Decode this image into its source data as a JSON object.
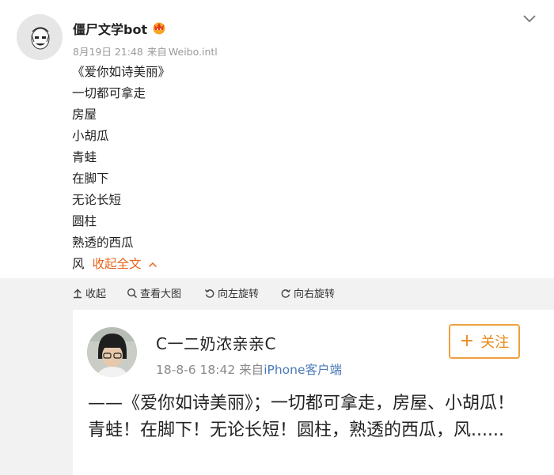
{
  "post": {
    "username": "僵尸文学bot",
    "date": "8月19日 21:48",
    "source_prefix": "来自",
    "source": "Weibo.intl",
    "lines": [
      "《爱你如诗美丽》",
      "一切都可拿走",
      "房屋",
      "小胡瓜",
      "青蛙",
      "在脚下",
      "无论长短",
      "圆柱",
      "熟透的西瓜",
      "风"
    ],
    "collapse_label": "收起全文"
  },
  "toolbar": {
    "items": [
      {
        "label": "收起",
        "icon": "collapse-arrow-icon"
      },
      {
        "label": "查看大图",
        "icon": "magnifier-icon"
      },
      {
        "label": "向左旋转",
        "icon": "rotate-left-icon"
      },
      {
        "label": "向右旋转",
        "icon": "rotate-right-icon"
      }
    ]
  },
  "repost": {
    "username": "C一二奶浓亲亲C",
    "date": "18-8-6 18:42",
    "source_prefix": "来自",
    "source": "iPhone客户端",
    "follow_label": "关注",
    "text": "——《爱你如诗美丽》；一切都可拿走，房屋、小胡瓜！青蛙！在脚下！无论长短！圆柱，熟透的西瓜，风......"
  },
  "colors": {
    "accent_orange": "#e8641b",
    "link_blue": "#4a7ab8",
    "toolbar_bg": "#f2f2f2"
  }
}
